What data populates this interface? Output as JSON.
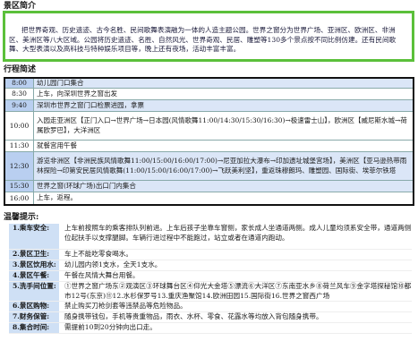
{
  "intro": {
    "title": "景区简介",
    "text": "把世界奇观、历史遗迹、古今名胜、民间歌舞表演融为一体的人造主题公园。世界之窗分为世界广场、亚洲区、欧洲区、非洲区、美洲区等八大区域。公园将历史遗迹、名胜、自然风光、世界奇观、民居、雕塑等130多个景点按不同比例仿建。还有民间歌舞、大型表演以及高科技与特种娱乐项目等，晚上还有夜场，活动丰富丰富。"
  },
  "itinerary": {
    "title": "行程简述",
    "rows": [
      {
        "time": "8:00",
        "desc": "幼儿园门口集合",
        "blue": true
      },
      {
        "time": "8:30",
        "desc": "上车，向深圳世界之窗出发",
        "blue": false
      },
      {
        "time": "9:40",
        "desc": "深圳市世界之窗门口检票进园，拿票",
        "blue": true
      },
      {
        "time": "10:00",
        "desc": "入园走亚洲区【正门入口→世界广场→日本园(风情歌舞11:00/14:30/15:30/16:30)→极速雷士山】，欧洲区【威尼斯水城→荷属欧罗巴】，大洋洲区",
        "blue": false
      },
      {
        "time": "11:30",
        "desc": "就餐宫用午餐",
        "blue": false
      },
      {
        "time": "12:30",
        "desc": "游览非洲区【非洲民族风情歌舞11:00/15:00/16:00/17:00)→尼亚加拉大瀑布→印加遗址城堡宫场】，美洲区【亚马逊热带雨林探险→印第安民居风情歌舞(11:00/15:00/16:00/17:00)→飞跃美利坚】，重返珠穆朗玛、雕塑园、国际街、埃菲尔铁塔",
        "blue": true
      },
      {
        "time": "15:30",
        "desc": "世界之窗(环球广场)出口门内集合",
        "blue": true
      },
      {
        "time": "16:00",
        "desc": "上车，返程。",
        "blue": false
      }
    ]
  },
  "tips": {
    "title": "温馨提示:",
    "items": [
      {
        "label": "1.乘车安全:",
        "text": "上车前按照车的乘客排队列前进。上车后孩子坐靠车窗侧，家长成人坐通道两侧。成人儿童均须系安全带，通道两侧位起扶手以支撑腿脚。车辆行进过程中不能跑过，站立或者在通道内跑动。"
      },
      {
        "label": "2.景区卫生:",
        "text": "车上不能吃零食喝水。"
      },
      {
        "label": "3.景区饮用水:",
        "text": "幼儿园内领1支水，全天1支水。"
      },
      {
        "label": "4.景区午餐:",
        "text": "午餐在风情大舞台用餐。"
      },
      {
        "label": "5.洗手间位置:",
        "text": "①世界之窗广场东②观演区③环球舞台区④仰光大金塔⑤漂流⑥大洋区⑦东南亚水乡⑧荷兰风车⑨金字塔探秘馆⑩都市12号(东京)⑪12.水杉保罗号13.重庆渔聚馆14.欧洲田园15.国际街16.世界之窗西广场"
      },
      {
        "label": "6.景区购物:",
        "text": "禁止购买刀枪剑套等违禁品等危险物品。"
      },
      {
        "label": "7.财务保管:",
        "text": "随身携带钱包，手机等贵重物品，雨衣、水杯、零食、花露水等均放入背包随身携带。"
      },
      {
        "label": "8.集合时间:",
        "text": "需提前10到20分钟向出口走。"
      }
    ]
  }
}
